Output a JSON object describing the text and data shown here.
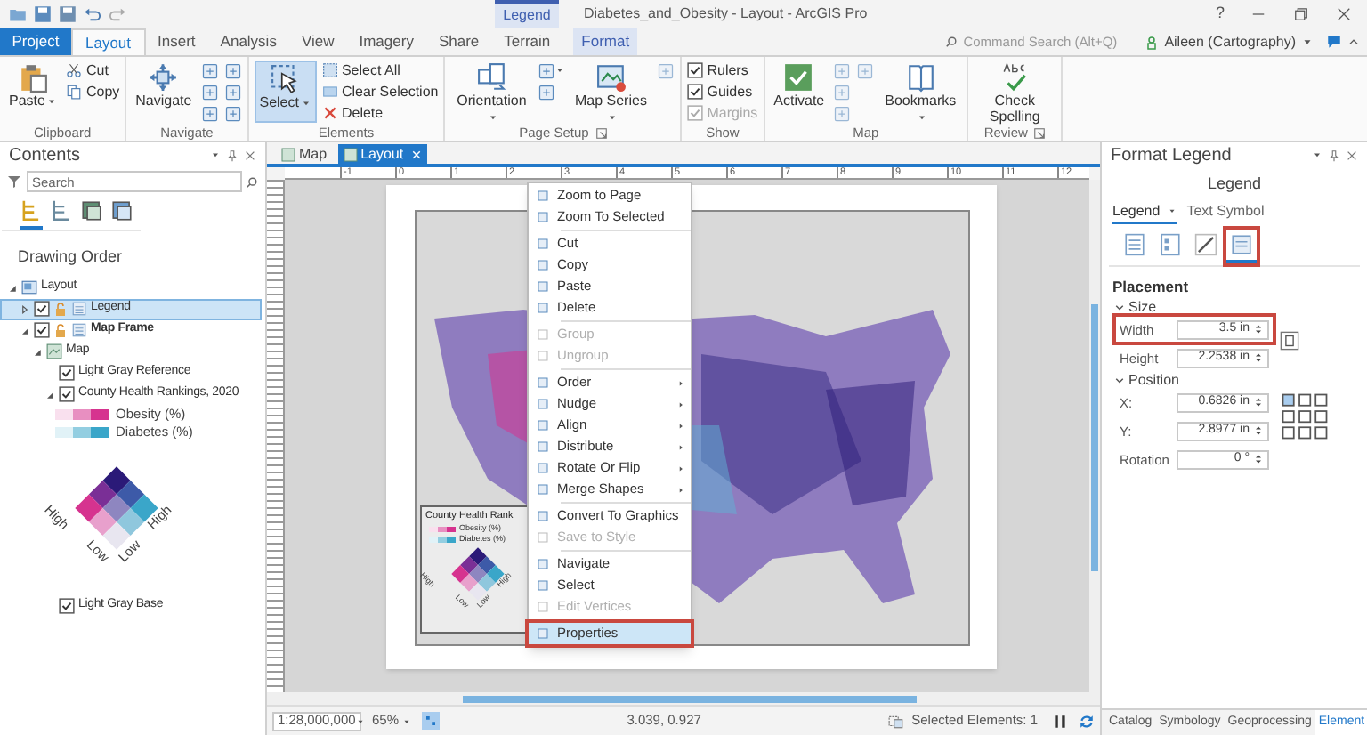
{
  "title_bar": {
    "contextual_label": "Legend",
    "title": "Diabetes_and_Obesity - Layout - ArcGIS Pro",
    "help": "?"
  },
  "ribbon_tabs": [
    {
      "label": "Project",
      "kind": "backstage",
      "selected": false
    },
    {
      "label": "Layout",
      "kind": "tab",
      "selected": true
    },
    {
      "label": "Insert",
      "kind": "tab",
      "selected": false
    },
    {
      "label": "Analysis",
      "kind": "tab",
      "selected": false
    },
    {
      "label": "View",
      "kind": "tab",
      "selected": false
    },
    {
      "label": "Imagery",
      "kind": "tab",
      "selected": false
    },
    {
      "label": "Share",
      "kind": "tab",
      "selected": false
    },
    {
      "label": "Terrain",
      "kind": "tab",
      "selected": false
    },
    {
      "label": "Format",
      "kind": "contextual",
      "selected": false
    }
  ],
  "command_search": {
    "placeholder": "Command Search (Alt+Q)"
  },
  "user": {
    "name": "Aileen (Cartography)"
  },
  "ribbon_groups": [
    {
      "label": "Clipboard",
      "launcher": false,
      "commands": [
        {
          "kind": "large",
          "label": "Paste",
          "menu": true,
          "active": false,
          "disabled": false
        },
        {
          "kind": "small",
          "label": "Cut",
          "menu": false,
          "active": false,
          "disabled": false
        },
        {
          "kind": "small",
          "label": "Copy",
          "menu": false,
          "active": false,
          "disabled": false
        }
      ]
    },
    {
      "label": "Navigate",
      "launcher": false,
      "commands": [
        {
          "kind": "large",
          "label": "Navigate",
          "menu": false,
          "active": false,
          "disabled": false
        },
        {
          "kind": "icon",
          "menu": false,
          "active": false,
          "disabled": false
        },
        {
          "kind": "icon",
          "menu": false,
          "active": false,
          "disabled": false
        },
        {
          "kind": "icon",
          "menu": false,
          "active": false,
          "disabled": false
        },
        {
          "kind": "icon",
          "menu": false,
          "active": false,
          "disabled": false
        },
        {
          "kind": "icon",
          "menu": false,
          "active": false,
          "disabled": false
        },
        {
          "kind": "icon",
          "menu": false,
          "active": false,
          "disabled": false
        }
      ]
    },
    {
      "label": "Elements",
      "launcher": false,
      "commands": [
        {
          "kind": "large",
          "label": "Select",
          "menu": true,
          "active": true,
          "disabled": false
        },
        {
          "kind": "small",
          "label": "Select All",
          "menu": false,
          "active": false,
          "disabled": false
        },
        {
          "kind": "small",
          "label": "Clear Selection",
          "menu": false,
          "active": false,
          "disabled": false
        },
        {
          "kind": "small",
          "label": "Delete",
          "menu": false,
          "active": false,
          "disabled": false
        }
      ]
    },
    {
      "label": "Page Setup",
      "launcher": true,
      "commands": [
        {
          "kind": "large",
          "label": "Orientation",
          "menu": true,
          "active": false,
          "disabled": false
        },
        {
          "kind": "icon",
          "menu": true,
          "active": false,
          "disabled": false
        },
        {
          "kind": "icon",
          "menu": false,
          "active": false,
          "disabled": false
        },
        {
          "kind": "large",
          "label": "Map Series",
          "menu": true,
          "active": false,
          "disabled": false
        },
        {
          "kind": "icon",
          "menu": false,
          "active": false,
          "disabled": true
        }
      ]
    },
    {
      "label": "Show",
      "launcher": false,
      "commands": [
        {
          "kind": "check",
          "label": "Rulers",
          "checked": true,
          "disabled": false
        },
        {
          "kind": "check",
          "label": "Guides",
          "checked": true,
          "disabled": false
        },
        {
          "kind": "check",
          "label": "Margins",
          "checked": true,
          "disabled": true
        }
      ]
    },
    {
      "label": "Map",
      "launcher": false,
      "commands": [
        {
          "kind": "large",
          "label": "Activate",
          "menu": false,
          "active": false,
          "disabled": false
        },
        {
          "kind": "icon",
          "menu": false,
          "active": false,
          "disabled": true
        },
        {
          "kind": "icon",
          "menu": false,
          "active": false,
          "disabled": true
        },
        {
          "kind": "icon",
          "menu": false,
          "active": false,
          "disabled": true
        },
        {
          "kind": "icon",
          "menu": false,
          "active": false,
          "disabled": true
        },
        {
          "kind": "large",
          "label": "Bookmarks",
          "menu": true,
          "active": false,
          "disabled": false
        }
      ]
    },
    {
      "label": "Review",
      "launcher": true,
      "commands": [
        {
          "kind": "large",
          "label": "Check Spelling",
          "menu": false,
          "active": false,
          "disabled": false
        }
      ]
    }
  ],
  "contents": {
    "title": "Contents",
    "search": {
      "placeholder": "Search"
    },
    "view_tabs": [
      {
        "selected": true
      },
      {
        "selected": false
      },
      {
        "selected": false
      },
      {
        "selected": false
      }
    ],
    "heading": "Drawing Order",
    "tree": [
      {
        "kind": "layout",
        "label": "Layout",
        "selected": false,
        "expanded": true,
        "children": [
          {
            "kind": "element",
            "label": "Legend",
            "selected": true,
            "checked": true,
            "bold": false,
            "expanded": false
          },
          {
            "kind": "element",
            "label": "Map Frame",
            "selected": false,
            "checked": true,
            "bold": true,
            "expanded": true,
            "children": [
              {
                "kind": "map",
                "label": "Map",
                "selected": false,
                "expanded": true,
                "children": [
                  {
                    "kind": "layer",
                    "label": "Light Gray Reference",
                    "selected": false,
                    "checked": true
                  },
                  {
                    "kind": "layer",
                    "label": "County Health Rankings, 2020",
                    "selected": false,
                    "checked": true,
                    "expanded": true,
                    "children": [
                      {
                        "kind": "patch",
                        "label": "Obesity (%)",
                        "color": "#d6338f"
                      },
                      {
                        "kind": "patch",
                        "label": "Diabetes (%)",
                        "color": "#3aa6c9"
                      },
                      {
                        "kind": "bivariate",
                        "axis_labels": [
                          "High",
                          "Low",
                          "Low",
                          "High"
                        ]
                      }
                    ]
                  },
                  {
                    "kind": "layer",
                    "label": "Light Gray Base",
                    "selected": false,
                    "checked": true
                  }
                ]
              }
            ]
          }
        ]
      }
    ]
  },
  "layout_view": {
    "doc_tabs": [
      {
        "label": "Map",
        "selected": false
      },
      {
        "label": "Layout",
        "selected": true
      }
    ],
    "ruler_labels": [
      "-1",
      "0",
      "1",
      "2",
      "3",
      "4",
      "5",
      "6",
      "7",
      "8",
      "9",
      "10",
      "11",
      "12"
    ],
    "page_legend": {
      "title": "County Health Rank",
      "items": [
        {
          "label": "Obesity (%)",
          "color": "#d6338f"
        },
        {
          "label": "Diabetes (%)",
          "color": "#3aa6c9"
        }
      ],
      "axis_labels": [
        "High",
        "Low",
        "Low",
        "High"
      ]
    },
    "context_menu": [
      {
        "items": [
          {
            "label": "Zoom to Page",
            "disabled": false,
            "submenu": false,
            "highlighted": false
          },
          {
            "label": "Zoom To Selected",
            "disabled": false,
            "submenu": false,
            "highlighted": false
          }
        ]
      },
      {
        "items": [
          {
            "label": "Cut",
            "disabled": false,
            "submenu": false,
            "highlighted": false
          },
          {
            "label": "Copy",
            "disabled": false,
            "submenu": false,
            "highlighted": false
          },
          {
            "label": "Paste",
            "disabled": false,
            "submenu": false,
            "highlighted": false
          },
          {
            "label": "Delete",
            "disabled": false,
            "submenu": false,
            "highlighted": false
          }
        ]
      },
      {
        "items": [
          {
            "label": "Group",
            "disabled": true,
            "submenu": false,
            "highlighted": false
          },
          {
            "label": "Ungroup",
            "disabled": true,
            "submenu": false,
            "highlighted": false
          }
        ]
      },
      {
        "items": [
          {
            "label": "Order",
            "disabled": false,
            "submenu": true,
            "highlighted": false
          },
          {
            "label": "Nudge",
            "disabled": false,
            "submenu": true,
            "highlighted": false
          },
          {
            "label": "Align",
            "disabled": false,
            "submenu": true,
            "highlighted": false
          },
          {
            "label": "Distribute",
            "disabled": false,
            "submenu": true,
            "highlighted": false
          },
          {
            "label": "Rotate Or Flip",
            "disabled": false,
            "submenu": true,
            "highlighted": false
          },
          {
            "label": "Merge Shapes",
            "disabled": false,
            "submenu": true,
            "highlighted": false
          }
        ]
      },
      {
        "items": [
          {
            "label": "Convert To Graphics",
            "disabled": false,
            "submenu": false,
            "highlighted": false
          },
          {
            "label": "Save to Style",
            "disabled": true,
            "submenu": false,
            "highlighted": false
          }
        ]
      },
      {
        "items": [
          {
            "label": "Navigate",
            "disabled": false,
            "submenu": false,
            "highlighted": false
          },
          {
            "label": "Select",
            "disabled": false,
            "submenu": false,
            "highlighted": false
          },
          {
            "label": "Edit Vertices",
            "disabled": true,
            "submenu": false,
            "highlighted": false
          }
        ]
      },
      {
        "items": [
          {
            "label": "Properties",
            "disabled": false,
            "submenu": false,
            "highlighted": true
          }
        ]
      }
    ],
    "status_bar": {
      "scale": "1:28,000,000",
      "zoom": "65%",
      "coordinates": "3.039, 0.927",
      "selection": "Selected Elements: 1"
    }
  },
  "format_pane": {
    "title": "Format Legend",
    "element": "Legend",
    "tabs": [
      {
        "label": "Legend",
        "selected": true
      },
      {
        "label": "Text Symbol",
        "selected": false
      }
    ],
    "icon_tabs": [
      {
        "selected": false,
        "highlighted": false
      },
      {
        "selected": false,
        "highlighted": false
      },
      {
        "selected": false,
        "highlighted": false
      },
      {
        "selected": true,
        "highlighted": true
      }
    ],
    "section": "Placement",
    "groups": [
      {
        "label": "Size",
        "expanded": true,
        "fields": [
          {
            "label": "Width",
            "value": "3.5 in",
            "highlighted": true
          },
          {
            "label": "Height",
            "value": "2.2538 in",
            "highlighted": false
          }
        ]
      },
      {
        "label": "Position",
        "expanded": true,
        "fields": [
          {
            "label": "X:",
            "value": "0.6826 in",
            "highlighted": false
          },
          {
            "label": "Y:",
            "value": "2.8977 in",
            "highlighted": false
          },
          {
            "label": "Rotation",
            "value": "0 °",
            "highlighted": false
          }
        ]
      }
    ],
    "bottom_tabs": [
      {
        "label": "Catalog",
        "selected": false
      },
      {
        "label": "Symbology",
        "selected": false
      },
      {
        "label": "Geoprocessing",
        "selected": false
      },
      {
        "label": "Element",
        "selected": true
      }
    ]
  }
}
